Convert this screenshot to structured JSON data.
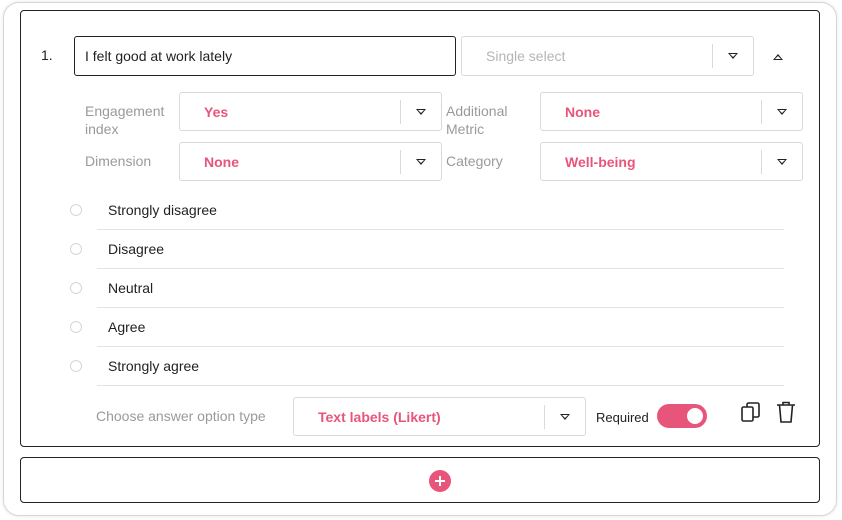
{
  "question": {
    "number": "1.",
    "text": "I felt good at work lately",
    "type_placeholder": "Single select"
  },
  "fields": {
    "engagement_index": {
      "label": "Engagement index",
      "value": "Yes"
    },
    "additional_metric": {
      "label": "Additional Metric",
      "value": "None"
    },
    "dimension": {
      "label": "Dimension",
      "value": "None"
    },
    "category": {
      "label": "Category",
      "value": "Well-being"
    }
  },
  "options": [
    "Strongly disagree",
    "Disagree",
    "Neutral",
    "Agree",
    "Strongly agree"
  ],
  "footer": {
    "answer_type_label": "Choose answer option type",
    "answer_type_value": "Text labels (Likert)",
    "required_label": "Required",
    "required_on": true
  },
  "icons": {
    "drag": "drag-handle-icon",
    "collapse": "caret-up-icon",
    "dropdown": "chevron-down-icon",
    "copy": "copy-icon",
    "delete": "trash-icon",
    "add": "plus-icon"
  },
  "colors": {
    "accent": "#e8557a",
    "muted": "#9a9a9a",
    "border": "#d9d9d9"
  }
}
